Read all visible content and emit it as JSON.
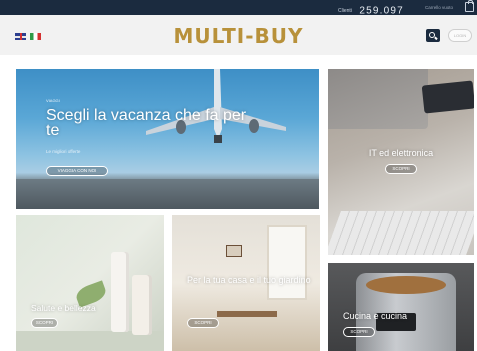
{
  "topbar": {
    "clients_label": "Clienti",
    "clients_count": "259.097",
    "cart_text": "Carrello vuoto"
  },
  "header": {
    "logo": "MULTI-BUY",
    "languages": [
      "english-flag",
      "italian-flag"
    ],
    "search_icon": "search-icon",
    "login_label": "LOGIN"
  },
  "tiles": {
    "hero": {
      "kicker": "VIAGGI",
      "title": "Scegli la vacanza che fa per te",
      "subtitle": "Le migliori offerte",
      "button": "VIAGGIA CON NOI"
    },
    "it": {
      "title": "IT ed elettronica",
      "button": "SCOPRI"
    },
    "salute": {
      "title": "Salute e bellezza",
      "button": "SCOPRI"
    },
    "casa": {
      "title": "Per la tua casa e il tuo giardino",
      "button": "SCOPRI"
    },
    "cucina": {
      "title": "Cucina e cucina",
      "button": "SCOPRI"
    }
  },
  "colors": {
    "topbar": "#1b2b3f",
    "logo_gold": "#b8913a",
    "header_bg": "#f2f2f2"
  }
}
